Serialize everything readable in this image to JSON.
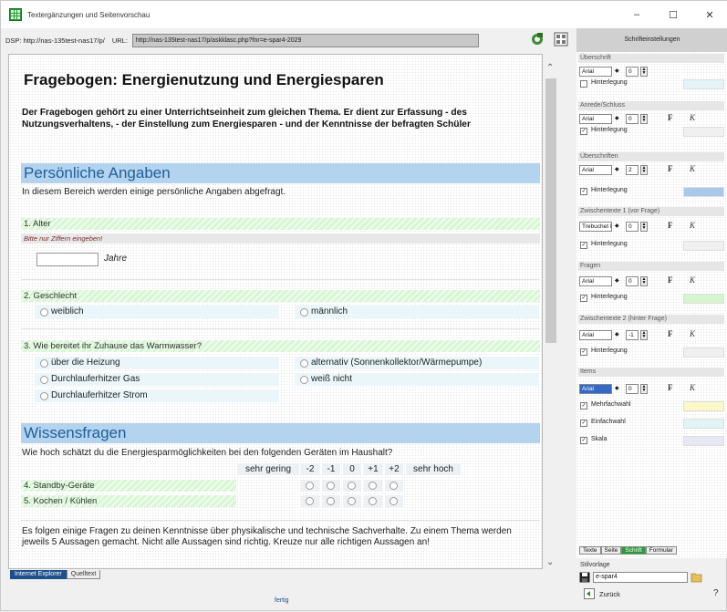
{
  "window": {
    "title": "Textergänzungen und Seitenvorschau",
    "buttons": [
      "–",
      "☐",
      "✕"
    ]
  },
  "urlbar": {
    "dsp": "DSP: http://nas-135test-nas17/p/",
    "url_label": "URL:",
    "url": "http://nas-135test-nas17/p/askklasc.php?fnr=e-spar4-2029"
  },
  "page": {
    "title": "Fragebogen: Energienutzung und Energiesparen",
    "intro": "Der Fragebogen gehört zu einer Unterrichtseinheit zum gleichen Thema. Er dient zur Erfassung - des Nutzungsverhaltens, - der Einstellung zum Energiesparen - und der Kenntnisse der befragten Schüler",
    "section1": {
      "title": "Persönliche Angaben",
      "text": "In diesem Bereich werden einige persönliche Angaben abgefragt.",
      "q1": {
        "label": "1. Alter",
        "hint": "Bitte nur Ziffern eingeben!",
        "unit": "Jahre"
      },
      "q2": {
        "label": "2. Geschlecht",
        "options": [
          "weiblich",
          "männlich"
        ]
      },
      "q3": {
        "label": "3. Wie bereitet ihr Zuhause das Warmwasser?",
        "options": [
          "über die Heizung",
          "alternativ (Sonnenkollektor/Wärmepumpe)",
          "Durchlauferhitzer Gas",
          "weiß nicht",
          "Durchlauferhitzer Strom"
        ]
      }
    },
    "section2": {
      "title": "Wissensfragen",
      "text": "Wie hoch schätzt du die Energiesparmöglichkeiten bei den folgenden Geräten im Haushalt?",
      "scale": {
        "low": "sehr gering",
        "values": [
          "-2",
          "-1",
          "0",
          "+1",
          "+2"
        ],
        "high": "sehr hoch"
      },
      "rows": [
        "4. Standby-Geräte",
        "5. Kochen / Kühlen"
      ]
    },
    "paragraph": "Es folgen einige Fragen zu deinen Kenntnisse über physikalische und technische Sachverhalte. Zu einem Thema werden jeweils 5 Aussagen gemacht. Nicht alle Aussagen sind richtig. Kreuze nur alle richtigen Aussagen an!"
  },
  "bottom": {
    "tabs": [
      "Internet Explorer",
      "Quelltext"
    ],
    "status": "fertig"
  },
  "panel": {
    "title": "Schrifteinstellungen",
    "groups": [
      {
        "label": "Überschrift",
        "font": "Arial",
        "size": "0",
        "checkbox": "Hinterlegung",
        "checked": false,
        "fk": false,
        "swatch": "#e4f4f8"
      },
      {
        "label": "Anrede/Schluss",
        "font": "Arial",
        "size": "0",
        "checkbox": "Hinterlegung",
        "checked": true,
        "fk": true,
        "swatch": "#f0f0f0"
      },
      {
        "label": "Überschriften",
        "font": "Arial",
        "size": "2",
        "checkbox": "Hinterlegung",
        "checked": true,
        "fk": true,
        "swatch": "#a9c8ea"
      },
      {
        "label": "Zwischentexte 1 (vor Frage)",
        "font": "Trebuchet MS",
        "size": "0",
        "checkbox": "Hinterlegung",
        "checked": true,
        "fk": true,
        "swatch": "#f0f0f0"
      },
      {
        "label": "Fragen",
        "font": "Arial",
        "size": "0",
        "checkbox": "Hinterlegung",
        "checked": true,
        "fk": true,
        "swatch": "#d6f4cf"
      },
      {
        "label": "Zwischentexte 2 (hinter Frage)",
        "font": "Arial",
        "size": "-1",
        "checkbox": "Hinterlegung",
        "checked": true,
        "fk": true,
        "swatch": "#f0f0f0"
      }
    ],
    "items": {
      "label": "Items",
      "font": "Arial",
      "size": "0",
      "checks": [
        {
          "label": "Mehrfachwahl",
          "swatch": "#fdf8c8"
        },
        {
          "label": "Einfachwahl",
          "swatch": "#e1f4f6"
        },
        {
          "label": "Skala",
          "swatch": "#e6e8f4"
        }
      ]
    },
    "fk": {
      "f": "F",
      "k": "K"
    },
    "tabs": [
      "Texte",
      "Seite",
      "Schrift",
      "Formular"
    ],
    "vorlage": {
      "label": "Stilvorlage",
      "value": "e-spar4"
    },
    "back": "Zurück",
    "help": "?"
  }
}
